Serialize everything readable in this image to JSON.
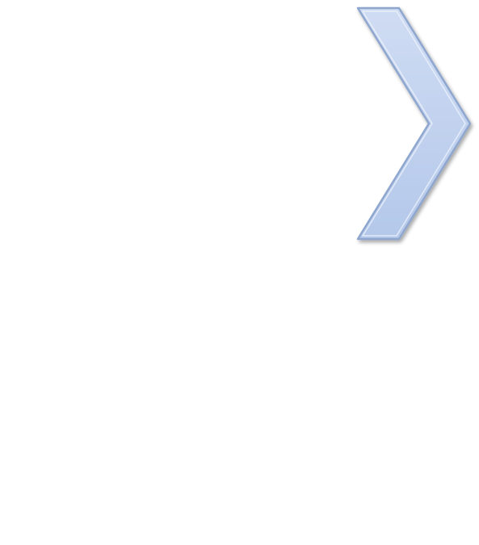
{
  "shape": {
    "icon": "chevron-right-icon",
    "fill_top": "#cfdcf3",
    "fill_bottom": "#b4c8ea",
    "stroke": "#8fa7cf",
    "highlight": "#eef3fb"
  },
  "background": "#ffffff"
}
